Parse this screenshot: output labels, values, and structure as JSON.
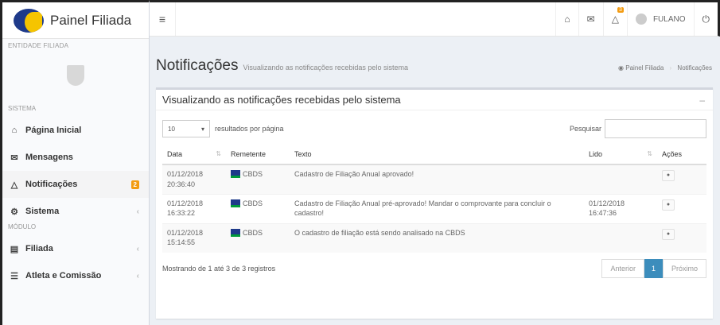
{
  "app": {
    "title": "Painel Filiada"
  },
  "sidebar": {
    "entity_label": "ENTIDADE FILIADA",
    "section_system": "SISTEMA",
    "section_module": "MÓDULO",
    "items": [
      {
        "label": "Página Inicial"
      },
      {
        "label": "Mensagens"
      },
      {
        "label": "Notificações",
        "badge": "2"
      },
      {
        "label": "Sistema"
      },
      {
        "label": "Filiada"
      },
      {
        "label": "Atleta e Comissão"
      }
    ]
  },
  "topbar": {
    "menu_icon": "≡",
    "user_name": "FULANO",
    "notif_count": "3"
  },
  "header": {
    "title": "Notificações",
    "subtitle": "Visualizando as notificações recebidas pelo sistema",
    "breadcrumb": [
      "Painel Filiada",
      "Notificações"
    ]
  },
  "box": {
    "title": "Visualizando as notificações recebidas pelo sistema",
    "collapse": "–"
  },
  "controls": {
    "page_size": "10",
    "page_size_label": "resultados por página",
    "search_label": "Pesquisar",
    "search_value": ""
  },
  "table": {
    "columns": [
      "Data",
      "Remetente",
      "Texto",
      "Lido",
      "Ações"
    ],
    "rows": [
      {
        "date": "01/12/2018",
        "time": "20:36:40",
        "sender": "CBDS",
        "text": "Cadastro de Filiação Anual aprovado!",
        "read": ""
      },
      {
        "date": "01/12/2018",
        "time": "16:33:22",
        "sender": "CBDS",
        "text": "Cadastro de Filiação Anual pré-aprovado! Mandar o comprovante para concluir o cadastro!",
        "read": "01/12/2018 16:47:36"
      },
      {
        "date": "01/12/2018",
        "time": "15:14:55",
        "sender": "CBDS",
        "text": "O cadastro de filiação está sendo analisado na CBDS",
        "read": ""
      }
    ]
  },
  "footer": {
    "info": "Mostrando de 1 até 3 de 3 registros",
    "prev": "Anterior",
    "page": "1",
    "next": "Próximo"
  },
  "colors": {
    "accent": "#3c8dbc",
    "badge": "#f39c12"
  }
}
